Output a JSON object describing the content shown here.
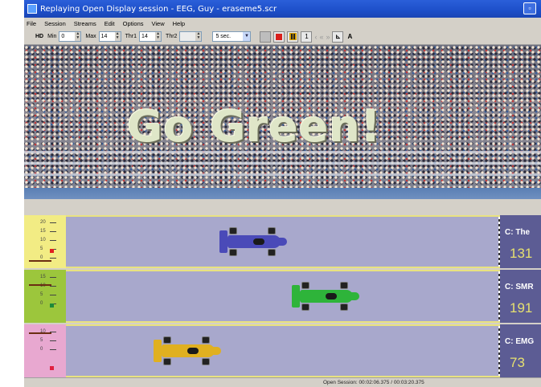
{
  "window": {
    "title": "Replaying Open Display session - EEG, Guy - eraseme5.scr"
  },
  "menu": [
    "File",
    "Session",
    "Streams",
    "Edit",
    "Options",
    "View",
    "Help"
  ],
  "toolbar": {
    "hd_label": "HD",
    "min_label": "Min",
    "min_value": "0",
    "max_label": "Max",
    "max_value": "14",
    "thr1_label": "Thr1",
    "thr1_value": "14",
    "thr2_label": "Thr2",
    "thr2_value": "",
    "duration_value": "5 sec.",
    "counter": "1",
    "text_button": "A"
  },
  "banner": {
    "slogan": "Go Green!"
  },
  "lanes": [
    {
      "gauge_color": "#f2ec84",
      "ticks": [
        "20",
        "15",
        "10",
        "5",
        "0"
      ],
      "marker_color": "#e02020",
      "label": "C: The",
      "value": "131",
      "car_color": "#4a4ab8",
      "car_progress": 0.42
    },
    {
      "gauge_color": "#9cc63c",
      "ticks": [
        "15",
        "10",
        "5",
        "0"
      ],
      "marker_color": "#1e8a3a",
      "label": "C: SMR",
      "value": "191",
      "car_color": "#2eb43a",
      "car_progress": 0.62
    },
    {
      "gauge_color": "#e8a8d0",
      "ticks": [
        "10",
        "5",
        "0"
      ],
      "marker_color": "#e02040",
      "label": "C: EMG",
      "value": "73",
      "car_color": "#e0b020",
      "car_progress": 0.24
    }
  ],
  "status": {
    "text": "Open Session: 00:02:06.375 / 00:03:20.375"
  }
}
